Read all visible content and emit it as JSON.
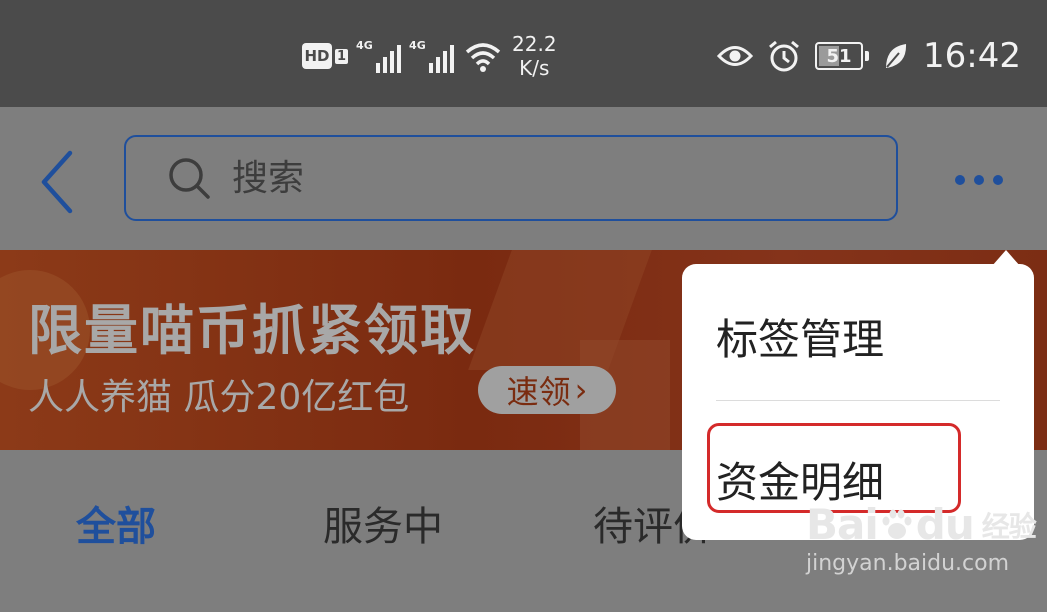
{
  "status_bar": {
    "hd": "HD",
    "sim": "1",
    "net1": "4G",
    "net2": "4G",
    "speed_value": "22.2",
    "speed_unit": "K/s",
    "battery_percent": "51",
    "battery_level": 0.51,
    "time": "16:42"
  },
  "search": {
    "placeholder": "搜索"
  },
  "banner": {
    "title": "限量喵币抓紧领取",
    "subtitle": "人人养猫 瓜分20亿红包",
    "button_label": "速领",
    "button_arrow": "›"
  },
  "tabs": [
    {
      "label": "全部",
      "active": true
    },
    {
      "label": "服务中",
      "active": false
    },
    {
      "label": "待评价",
      "active": false
    }
  ],
  "menu": {
    "items": [
      {
        "label": "标签管理"
      },
      {
        "label": "资金明细"
      }
    ]
  },
  "watermark": {
    "logo_left": "Bai",
    "logo_right": "du",
    "product": "经验",
    "url": "jingyan.baidu.com"
  },
  "colors": {
    "accent": "#1f4f9c",
    "highlight": "#d42a2a",
    "status_bar": "#4b4b4b",
    "dim_overlay": "#7e7e7e"
  }
}
